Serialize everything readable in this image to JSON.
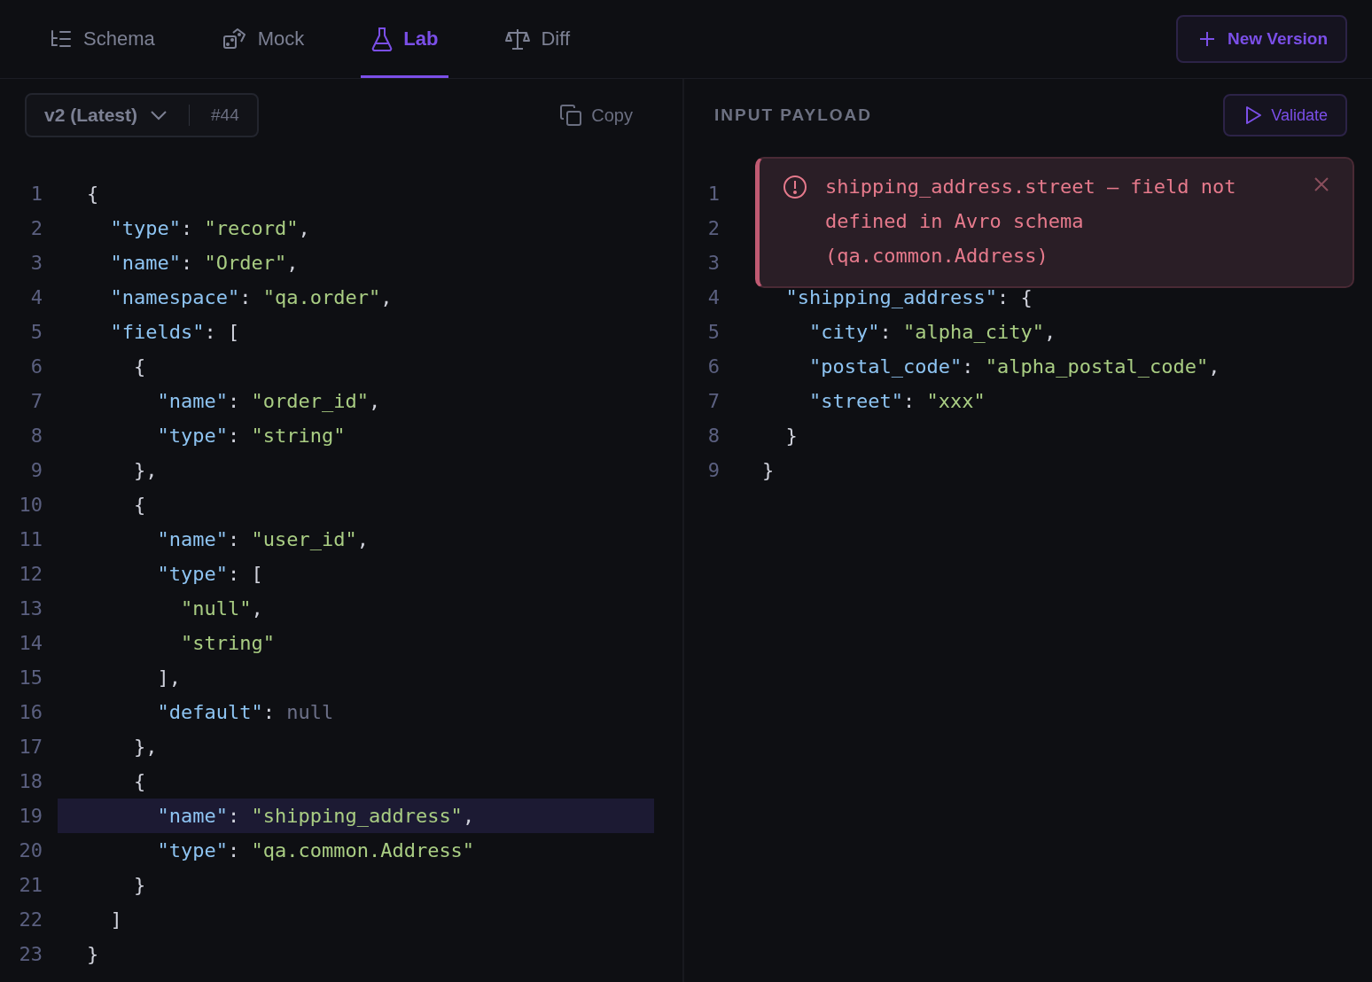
{
  "tabs": [
    {
      "label": "Schema",
      "selected": false
    },
    {
      "label": "Mock",
      "selected": false
    },
    {
      "label": "Lab",
      "selected": true
    },
    {
      "label": "Diff",
      "selected": false
    }
  ],
  "new_version_button": "New Version",
  "schema_panel": {
    "version": "v2 (Latest)",
    "revision": "#44",
    "copy_label": "Copy",
    "lines": [
      {
        "num": "1",
        "highlighted": false,
        "tokens": [
          {
            "kind": "punct",
            "text": "{"
          }
        ]
      },
      {
        "num": "2",
        "highlighted": false,
        "tokens": [
          {
            "kind": "key",
            "text": "  \"type\""
          },
          {
            "kind": "punct",
            "text": ": "
          },
          {
            "kind": "string",
            "text": "\"record\""
          },
          {
            "kind": "punct",
            "text": ","
          }
        ]
      },
      {
        "num": "3",
        "highlighted": false,
        "tokens": [
          {
            "kind": "key",
            "text": "  \"name\""
          },
          {
            "kind": "punct",
            "text": ": "
          },
          {
            "kind": "string",
            "text": "\"Order\""
          },
          {
            "kind": "punct",
            "text": ","
          }
        ]
      },
      {
        "num": "4",
        "highlighted": false,
        "tokens": [
          {
            "kind": "key",
            "text": "  \"namespace\""
          },
          {
            "kind": "punct",
            "text": ": "
          },
          {
            "kind": "string",
            "text": "\"qa.order\""
          },
          {
            "kind": "punct",
            "text": ","
          }
        ]
      },
      {
        "num": "5",
        "highlighted": false,
        "tokens": [
          {
            "kind": "key",
            "text": "  \"fields\""
          },
          {
            "kind": "punct",
            "text": ": ["
          }
        ]
      },
      {
        "num": "6",
        "highlighted": false,
        "tokens": [
          {
            "kind": "punct",
            "text": "    {"
          }
        ]
      },
      {
        "num": "7",
        "highlighted": false,
        "tokens": [
          {
            "kind": "key",
            "text": "      \"name\""
          },
          {
            "kind": "punct",
            "text": ": "
          },
          {
            "kind": "string",
            "text": "\"order_id\""
          },
          {
            "kind": "punct",
            "text": ","
          }
        ]
      },
      {
        "num": "8",
        "highlighted": false,
        "tokens": [
          {
            "kind": "key",
            "text": "      \"type\""
          },
          {
            "kind": "punct",
            "text": ": "
          },
          {
            "kind": "string",
            "text": "\"string\""
          }
        ]
      },
      {
        "num": "9",
        "highlighted": false,
        "tokens": [
          {
            "kind": "punct",
            "text": "    },"
          }
        ]
      },
      {
        "num": "10",
        "highlighted": false,
        "tokens": [
          {
            "kind": "punct",
            "text": "    {"
          }
        ]
      },
      {
        "num": "11",
        "highlighted": false,
        "tokens": [
          {
            "kind": "key",
            "text": "      \"name\""
          },
          {
            "kind": "punct",
            "text": ": "
          },
          {
            "kind": "string",
            "text": "\"user_id\""
          },
          {
            "kind": "punct",
            "text": ","
          }
        ]
      },
      {
        "num": "12",
        "highlighted": false,
        "tokens": [
          {
            "kind": "key",
            "text": "      \"type\""
          },
          {
            "kind": "punct",
            "text": ": ["
          }
        ]
      },
      {
        "num": "13",
        "highlighted": false,
        "tokens": [
          {
            "kind": "string",
            "text": "        \"null\""
          },
          {
            "kind": "punct",
            "text": ","
          }
        ]
      },
      {
        "num": "14",
        "highlighted": false,
        "tokens": [
          {
            "kind": "string",
            "text": "        \"string\""
          }
        ]
      },
      {
        "num": "15",
        "highlighted": false,
        "tokens": [
          {
            "kind": "punct",
            "text": "      ],"
          }
        ]
      },
      {
        "num": "16",
        "highlighted": false,
        "tokens": [
          {
            "kind": "key",
            "text": "      \"default\""
          },
          {
            "kind": "punct",
            "text": ": "
          },
          {
            "kind": "null",
            "text": "null"
          }
        ]
      },
      {
        "num": "17",
        "highlighted": false,
        "tokens": [
          {
            "kind": "punct",
            "text": "    },"
          }
        ]
      },
      {
        "num": "18",
        "highlighted": false,
        "tokens": [
          {
            "kind": "punct",
            "text": "    {"
          }
        ]
      },
      {
        "num": "19",
        "highlighted": true,
        "tokens": [
          {
            "kind": "key",
            "text": "      \"name\""
          },
          {
            "kind": "punct",
            "text": ": "
          },
          {
            "kind": "string",
            "text": "\"shipping_address\""
          },
          {
            "kind": "punct",
            "text": ","
          }
        ]
      },
      {
        "num": "20",
        "highlighted": false,
        "tokens": [
          {
            "kind": "key",
            "text": "      \"type\""
          },
          {
            "kind": "punct",
            "text": ": "
          },
          {
            "kind": "string",
            "text": "\"qa.common.Address\""
          }
        ]
      },
      {
        "num": "21",
        "highlighted": false,
        "tokens": [
          {
            "kind": "punct",
            "text": "    }"
          }
        ]
      },
      {
        "num": "22",
        "highlighted": false,
        "tokens": [
          {
            "kind": "punct",
            "text": "  ]"
          }
        ]
      },
      {
        "num": "23",
        "highlighted": false,
        "tokens": [
          {
            "kind": "punct",
            "text": "}"
          }
        ]
      }
    ]
  },
  "payload_panel": {
    "title": "INPUT PAYLOAD",
    "validate_button": "Validate",
    "error": "shipping_address.street — field not defined in Avro schema (qa.common.Address)",
    "lines": [
      {
        "num": "1"
      },
      {
        "num": "2"
      },
      {
        "num": "3"
      },
      {
        "num": "4",
        "tokens": [
          {
            "kind": "key",
            "text": "  \"shipping_address\""
          },
          {
            "kind": "punct",
            "text": ": {"
          }
        ]
      },
      {
        "num": "5",
        "tokens": [
          {
            "kind": "key",
            "text": "    \"city\""
          },
          {
            "kind": "punct",
            "text": ": "
          },
          {
            "kind": "string",
            "text": "\"alpha_city\""
          },
          {
            "kind": "punct",
            "text": ","
          }
        ]
      },
      {
        "num": "6",
        "tokens": [
          {
            "kind": "key",
            "text": "    \"postal_code\""
          },
          {
            "kind": "punct",
            "text": ": "
          },
          {
            "kind": "string",
            "text": "\"alpha_postal_code\""
          },
          {
            "kind": "punct",
            "text": ","
          }
        ]
      },
      {
        "num": "7",
        "tokens": [
          {
            "kind": "key",
            "text": "    \"street\""
          },
          {
            "kind": "punct",
            "text": ": "
          },
          {
            "kind": "string",
            "text": "\"xxx\""
          }
        ]
      },
      {
        "num": "8",
        "tokens": [
          {
            "kind": "punct",
            "text": "  }"
          }
        ]
      },
      {
        "num": "9",
        "tokens": [
          {
            "kind": "punct",
            "text": "}"
          }
        ]
      }
    ]
  }
}
